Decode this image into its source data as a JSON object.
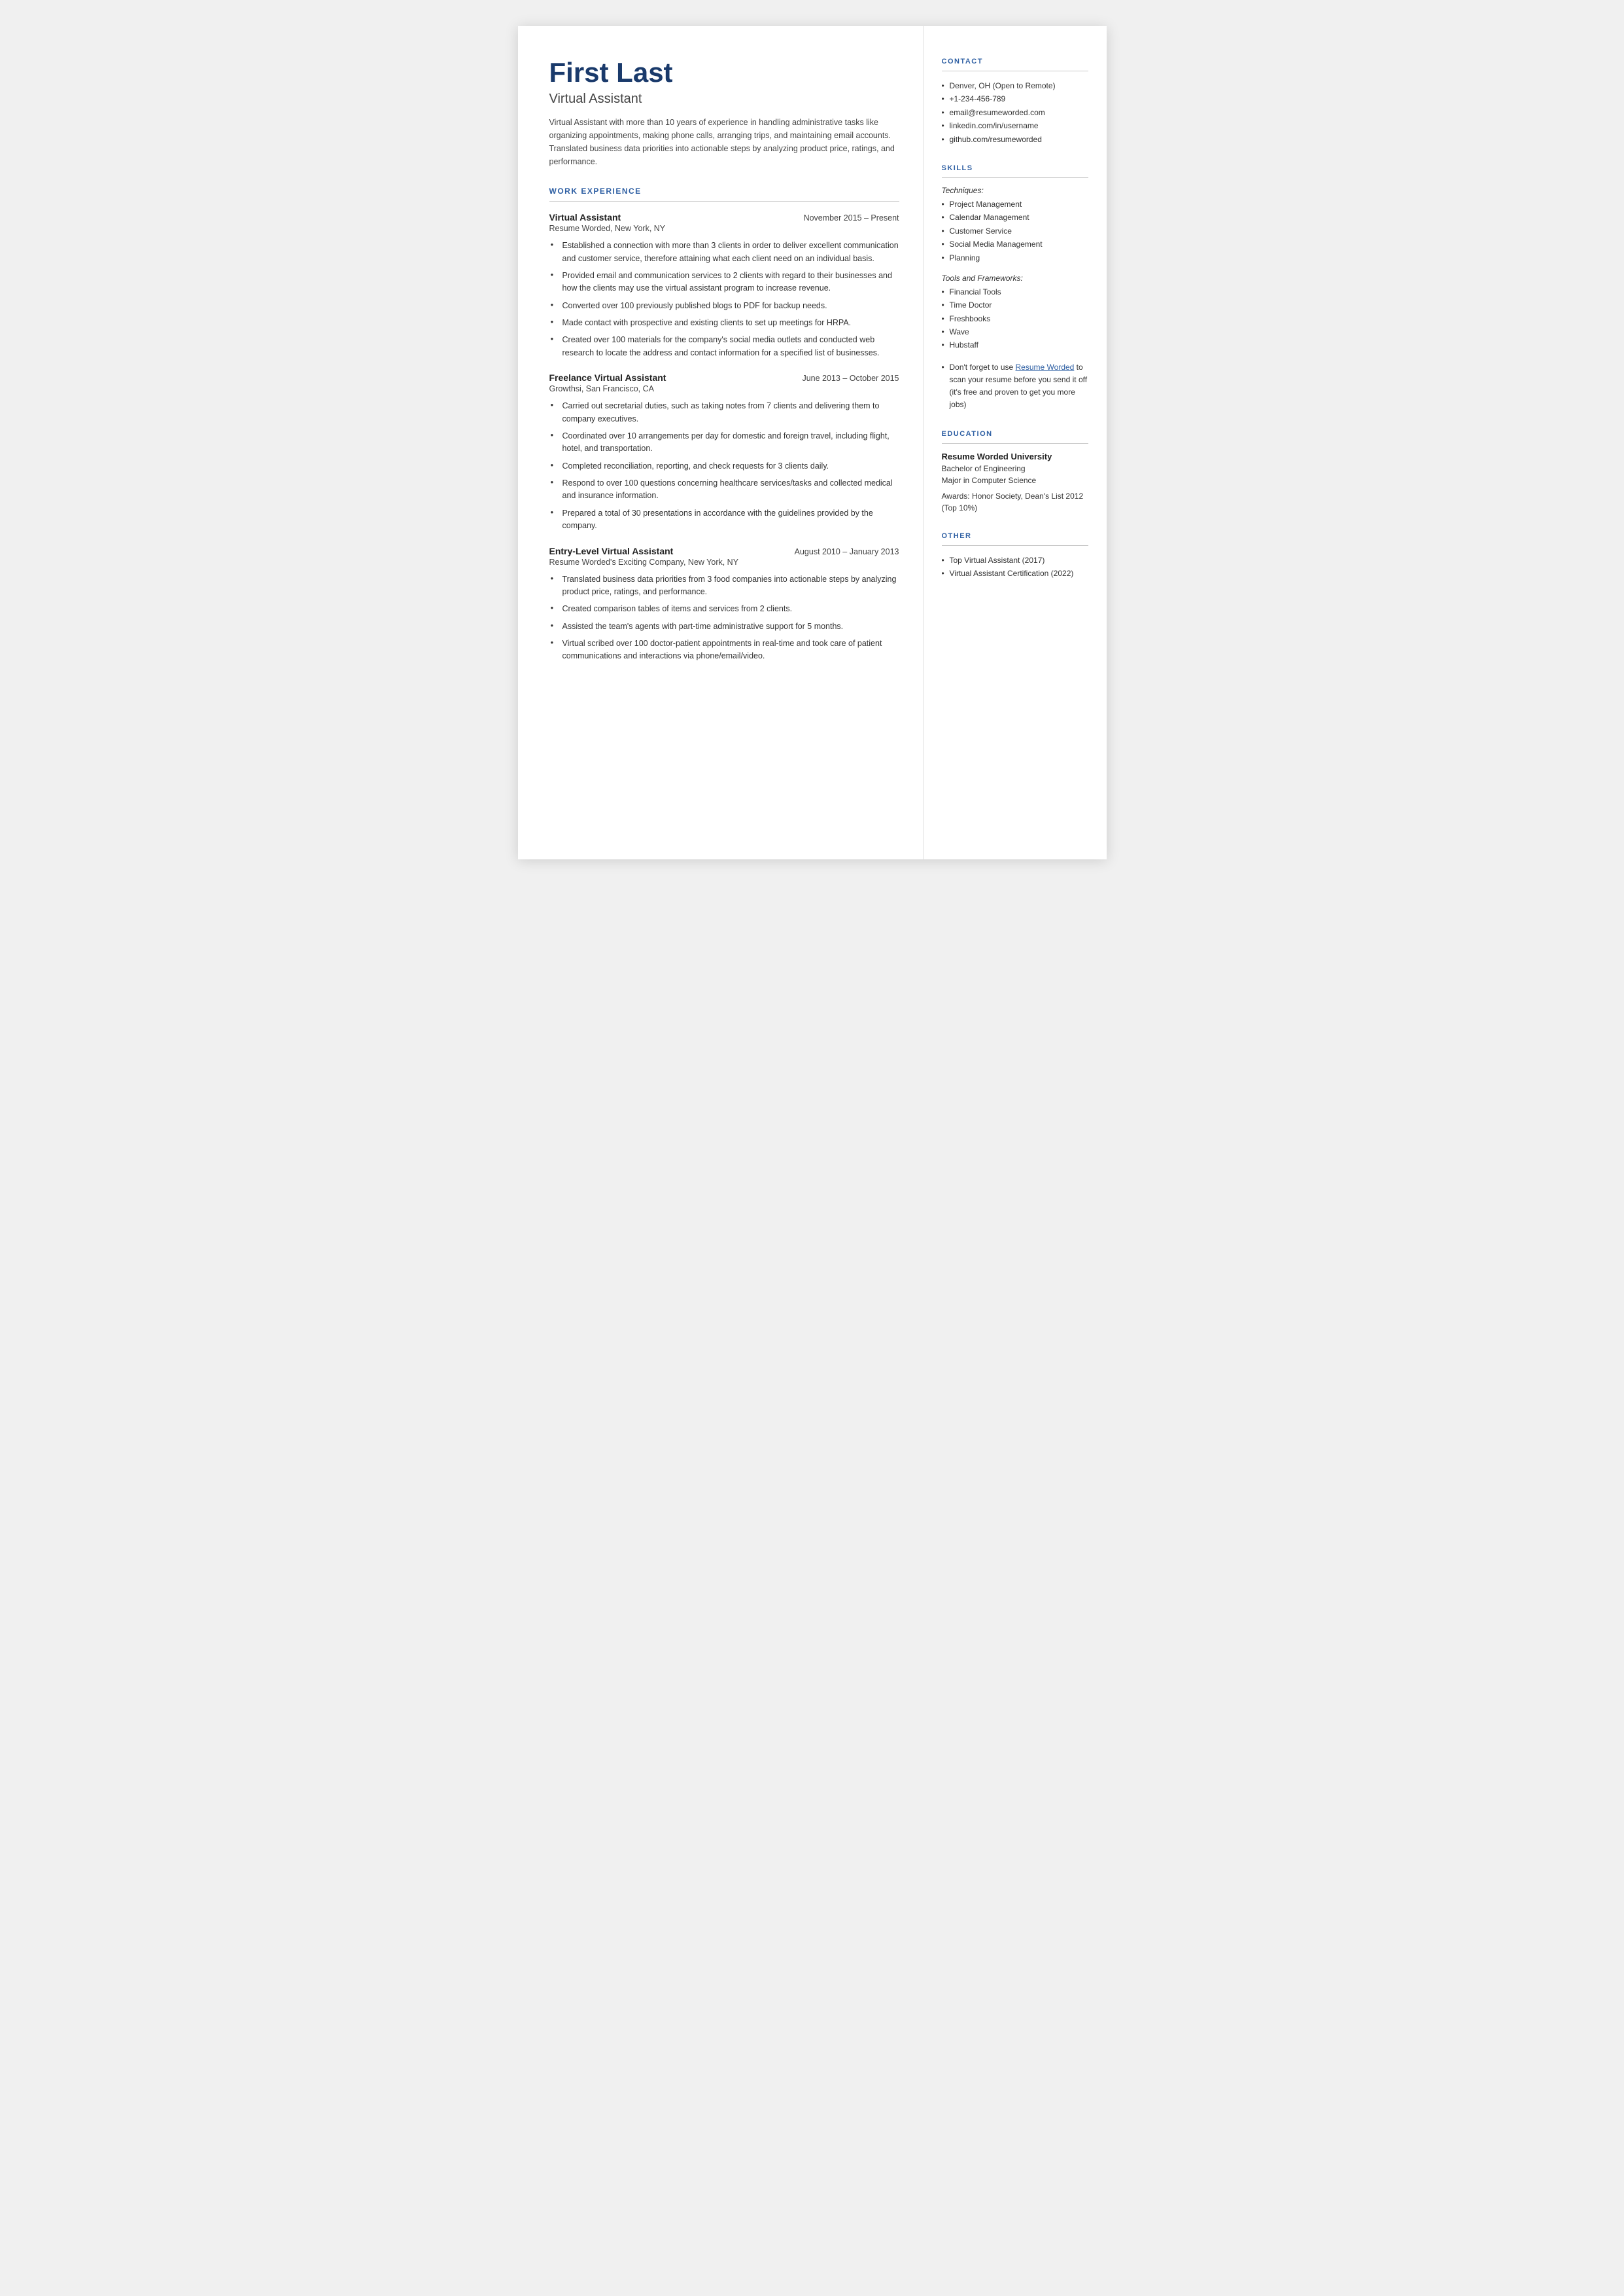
{
  "header": {
    "name": "First Last",
    "job_title": "Virtual Assistant",
    "summary": "Virtual Assistant with more than 10 years of experience in handling administrative tasks like organizing appointments, making phone calls, arranging trips, and maintaining email accounts. Translated business data priorities into actionable steps by analyzing product price, ratings, and performance."
  },
  "work_experience": {
    "section_title": "WORK EXPERIENCE",
    "jobs": [
      {
        "title": "Virtual Assistant",
        "dates": "November 2015 – Present",
        "company": "Resume Worded, New York, NY",
        "bullets": [
          "Established a connection with more than 3 clients in order to deliver excellent communication and customer service, therefore attaining what each client need on an individual basis.",
          "Provided email and communication services to 2 clients with regard to their businesses and how the clients may use the virtual assistant program to increase revenue.",
          "Converted over 100 previously published blogs to PDF for backup needs.",
          "Made contact with prospective and existing clients to set up meetings for HRPA.",
          "Created over 100 materials for the company's social media outlets and conducted web research to locate the address and contact information for a specified list of businesses."
        ]
      },
      {
        "title": "Freelance Virtual Assistant",
        "dates": "June 2013 – October 2015",
        "company": "Growthsi, San Francisco, CA",
        "bullets": [
          "Carried out secretarial duties, such as taking notes from 7 clients and delivering them to company executives.",
          "Coordinated over 10 arrangements per day for domestic and foreign travel, including flight, hotel, and transportation.",
          "Completed reconciliation, reporting, and check requests for 3 clients daily.",
          "Respond to over 100 questions concerning healthcare services/tasks and collected medical and insurance information.",
          "Prepared a total of 30 presentations in accordance with the guidelines provided by the company."
        ]
      },
      {
        "title": "Entry-Level Virtual Assistant",
        "dates": "August 2010 – January 2013",
        "company": "Resume Worded's Exciting Company, New York, NY",
        "bullets": [
          "Translated business data priorities from 3 food companies into actionable steps by analyzing product price, ratings, and performance.",
          "Created comparison tables of items and services from 2 clients.",
          "Assisted the team's agents with part-time administrative support for 5 months.",
          "Virtual scribed over 100 doctor-patient appointments in real-time and took care of patient communications and interactions via phone/email/video."
        ]
      }
    ]
  },
  "contact": {
    "section_title": "CONTACT",
    "items": [
      "Denver, OH (Open to Remote)",
      "+1-234-456-789",
      "email@resumeworded.com",
      "linkedin.com/in/username",
      "github.com/resumeworded"
    ]
  },
  "skills": {
    "section_title": "SKILLS",
    "techniques_label": "Techniques:",
    "techniques": [
      "Project Management",
      "Calendar Management",
      "Customer Service",
      "Social Media Management",
      "Planning"
    ],
    "tools_label": "Tools and Frameworks:",
    "tools": [
      "Financial Tools",
      "Time Doctor",
      "Freshbooks",
      "Wave",
      "Hubstaff"
    ],
    "note_prefix": "Don't forget to use ",
    "note_link_text": "Resume Worded",
    "note_suffix": " to scan your resume before you send it off (it's free and proven to get you more jobs)"
  },
  "education": {
    "section_title": "EDUCATION",
    "school": "Resume Worded University",
    "degree": "Bachelor of Engineering",
    "major": "Major in Computer Science",
    "awards": "Awards: Honor Society, Dean's List 2012 (Top 10%)"
  },
  "other": {
    "section_title": "OTHER",
    "items": [
      "Top Virtual Assistant (2017)",
      "Virtual Assistant Certification (2022)"
    ]
  }
}
